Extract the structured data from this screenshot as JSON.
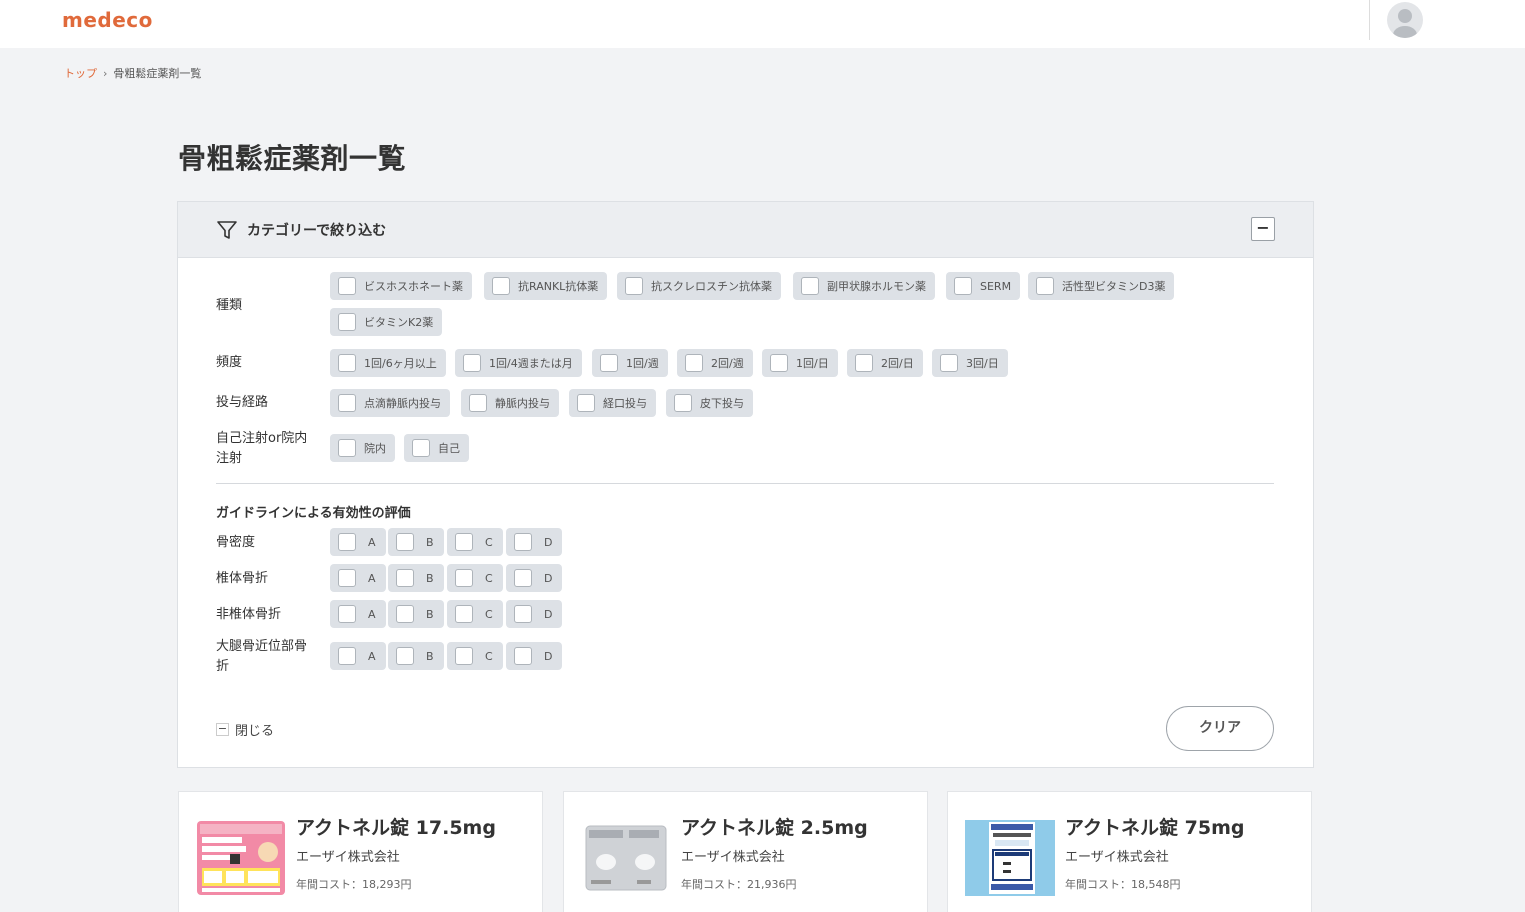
{
  "header": {
    "logo": "medeco"
  },
  "breadcrumb": {
    "home": "トップ",
    "current": "骨粗鬆症薬剤一覧"
  },
  "page": {
    "title": "骨粗鬆症薬剤一覧"
  },
  "filter": {
    "title": "カテゴリーで絞り込む",
    "collapse_symbol": "−",
    "types": {
      "label": "種類",
      "options": [
        "ビスホスホネート薬",
        "抗RANKL抗体薬",
        "抗スクレロスチン抗体薬",
        "副甲状腺ホルモン薬",
        "SERM",
        "活性型ビタミンD3薬",
        "ビタミンK2薬"
      ]
    },
    "frequency": {
      "label": "頻度",
      "options": [
        "1回/6ヶ月以上",
        "1回/4週または月",
        "1回/週",
        "2回/週",
        "1回/日",
        "2回/日",
        "3回/日"
      ]
    },
    "route": {
      "label": "投与経路",
      "options": [
        "点滴静脈内投与",
        "静脈内投与",
        "経口投与",
        "皮下投与"
      ]
    },
    "injection": {
      "label": "自己注射or院内注射",
      "options": [
        "院内",
        "自己"
      ]
    },
    "guideline": {
      "title": "ガイドラインによる有効性の評価",
      "grades": [
        "A",
        "B",
        "C",
        "D"
      ],
      "rows": [
        {
          "label": "骨密度"
        },
        {
          "label": "椎体骨折"
        },
        {
          "label": "非椎体骨折"
        },
        {
          "label": "大腿骨近位部骨折"
        }
      ]
    },
    "close_label": "閉じる",
    "clear_label": "クリア"
  },
  "products": [
    {
      "name": "アクトネル錠 17.5mg",
      "maker": "エーザイ株式会社",
      "cost": "年間コスト：18,293円",
      "image_icon": "package-pink-image"
    },
    {
      "name": "アクトネル錠 2.5mg",
      "maker": "エーザイ株式会社",
      "cost": "年間コスト：21,936円",
      "image_icon": "blister-pack-image"
    },
    {
      "name": "アクトネル錠 75mg",
      "maker": "エーザイ株式会社",
      "cost": "年間コスト：18,548円",
      "image_icon": "package-blue-image"
    }
  ]
}
